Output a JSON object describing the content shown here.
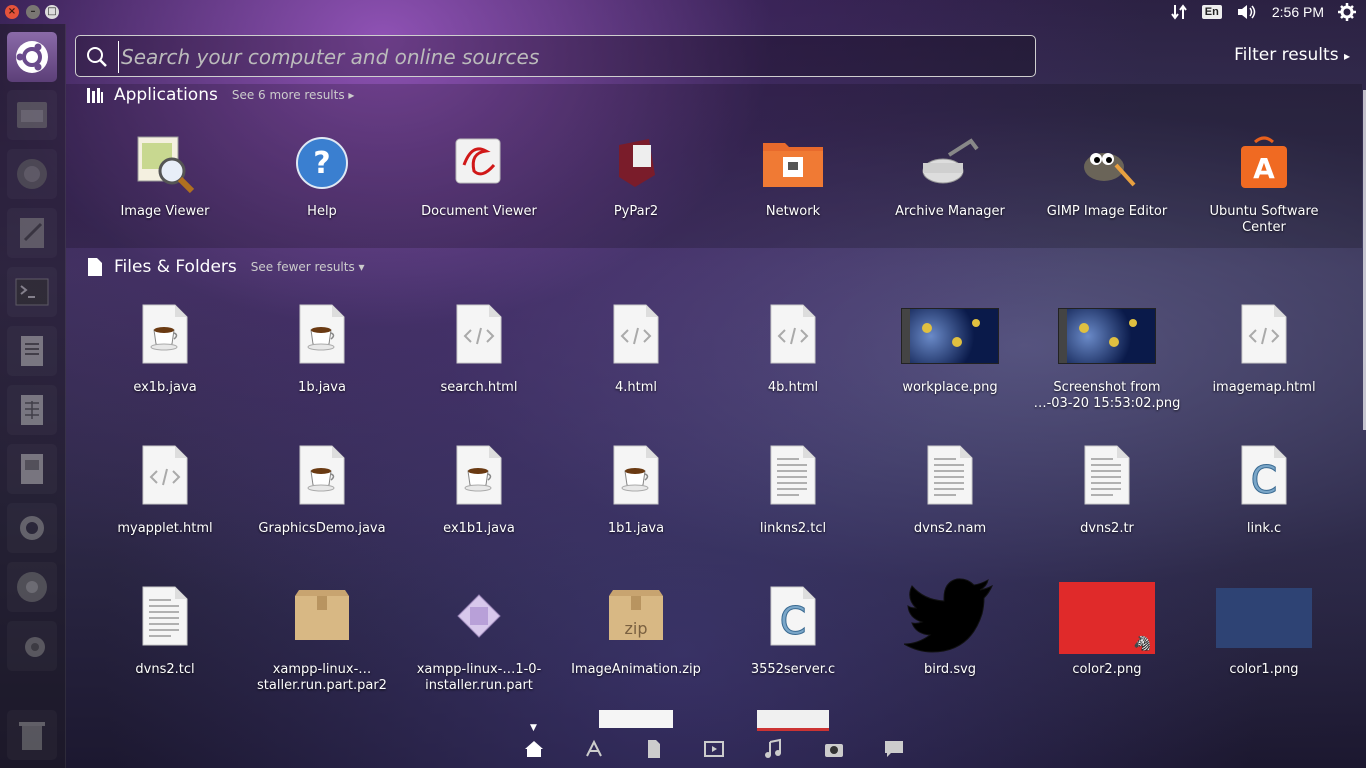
{
  "panel": {
    "language": "En",
    "clock": "2:56 PM"
  },
  "search": {
    "placeholder": "Search your computer and online sources",
    "filter_label": "Filter results"
  },
  "applications": {
    "title": "Applications",
    "more": "See 6 more results",
    "items": [
      {
        "label": "Image Viewer",
        "icon": "image-viewer-icon"
      },
      {
        "label": "Help",
        "icon": "help-icon"
      },
      {
        "label": "Document Viewer",
        "icon": "document-viewer-icon"
      },
      {
        "label": "PyPar2",
        "icon": "pypar2-icon"
      },
      {
        "label": "Network",
        "icon": "network-folder-icon"
      },
      {
        "label": "Archive Manager",
        "icon": "archive-manager-icon"
      },
      {
        "label": "GIMP Image Editor",
        "icon": "gimp-icon"
      },
      {
        "label": "Ubuntu Software Center",
        "icon": "software-center-icon"
      }
    ]
  },
  "files": {
    "title": "Files & Folders",
    "more": "See fewer results",
    "items": [
      {
        "label": "ex1b.java",
        "icon": "java-file-icon"
      },
      {
        "label": "1b.java",
        "icon": "java-file-icon"
      },
      {
        "label": "search.html",
        "icon": "html-file-icon"
      },
      {
        "label": "4.html",
        "icon": "html-file-icon"
      },
      {
        "label": "4b.html",
        "icon": "html-file-icon"
      },
      {
        "label": "workplace.png",
        "icon": "image-thumbnail"
      },
      {
        "label": "Screenshot from …-03-20 15:53:02.png",
        "icon": "image-thumbnail"
      },
      {
        "label": "imagemap.html",
        "icon": "html-file-icon"
      },
      {
        "label": "myapplet.html",
        "icon": "html-file-icon"
      },
      {
        "label": "GraphicsDemo.java",
        "icon": "java-file-icon"
      },
      {
        "label": "ex1b1.java",
        "icon": "java-file-icon"
      },
      {
        "label": "1b1.java",
        "icon": "java-file-icon"
      },
      {
        "label": "linkns2.tcl",
        "icon": "text-file-icon"
      },
      {
        "label": "dvns2.nam",
        "icon": "text-file-icon"
      },
      {
        "label": "dvns2.tr",
        "icon": "text-file-icon"
      },
      {
        "label": "link.c",
        "icon": "c-file-icon"
      },
      {
        "label": "dvns2.tcl",
        "icon": "text-file-icon"
      },
      {
        "label": "xampp-linux-…staller.run.part.par2",
        "icon": "package-icon"
      },
      {
        "label": "xampp-linux-…1-0-installer.run.part",
        "icon": "installer-icon"
      },
      {
        "label": "ImageAnimation.zip",
        "icon": "zip-icon"
      },
      {
        "label": "3552server.c",
        "icon": "c-file-icon"
      },
      {
        "label": "bird.svg",
        "icon": "twitter-bird-icon"
      },
      {
        "label": "color2.png",
        "icon": "red-thumbnail"
      },
      {
        "label": "color1.png",
        "icon": "blue-thumbnail"
      }
    ]
  },
  "colors": {
    "color2": "#e02a2a",
    "color1": "#2e4374",
    "home_accent": "#6a4a8c"
  },
  "lens_bar": [
    "home-lens-icon",
    "applications-lens-icon",
    "files-lens-icon",
    "video-lens-icon",
    "music-lens-icon",
    "photo-lens-icon",
    "social-lens-icon"
  ]
}
